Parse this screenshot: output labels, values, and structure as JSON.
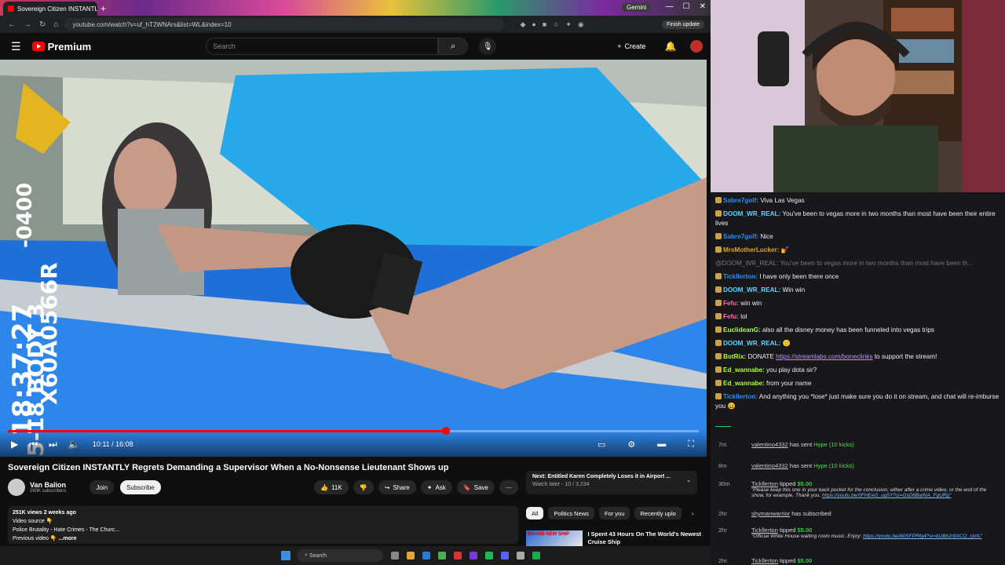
{
  "browser": {
    "tab_title": "Sovereign Citizen INSTANTLY R...",
    "new_tab": "+",
    "gemini": "Gemini",
    "url": "youtube.com/watch?v=uf_hT2WNArs&list=WL&index=10",
    "finish_update": "Finish update"
  },
  "youtube": {
    "logo": "Premium",
    "search_placeholder": "Search",
    "create": "Create"
  },
  "video": {
    "progress_fraction": 0.634,
    "time": "10:11 / 16:08",
    "overlay_text": "-0400",
    "overlay_text2": "18:37:27",
    "overlay_text3": "X60A0566R",
    "overlay_text4": "5-18  BODY 3"
  },
  "details": {
    "title": "Sovereign Citizen INSTANTLY Regrets Demanding a Supervisor When a No-Nonsense Lieutenant Shows up",
    "channel": "Van Balion",
    "subscribers": "260K subscribers",
    "join": "Join",
    "subscribe": "Subscribe",
    "likes": "11K",
    "share": "Share",
    "ask": "Ask",
    "save": "Save",
    "meta": "251K views  2 weeks ago",
    "desc_line1": "Video source 👇",
    "desc_line2": "Police Brutality - Hate Crimes - The Churc...",
    "desc_line3": "Previous video 👇",
    "more": "...more"
  },
  "next": {
    "label": "Next: Entitled Karen Completely Loses it in Airport ...",
    "sub": "Watch later - 10 / 3,234"
  },
  "chips": [
    "All",
    "Politics News",
    "For you",
    "Recently uplo"
  ],
  "recommendation": {
    "thumb_text": "BRAND NEW SHIP",
    "title": "I Spent 43 Hours On The World's Newest Cruise Ship"
  },
  "taskbar": {
    "search": "Search"
  },
  "chat": [
    {
      "user": "Sabre7golf",
      "color": "#1e90ff",
      "text": " Viva Las Vegas"
    },
    {
      "user": "DOOM_WR_REAL",
      "color": "#5bd3ff",
      "text": " You've been to vegas more in two months than most have been their entire lives"
    },
    {
      "user": "Sabre7golf",
      "color": "#1e90ff",
      "text": " Nice"
    },
    {
      "user": "MrsMotherLucker",
      "color": "#daa520",
      "text": " 💅"
    },
    {
      "user": "",
      "color": "#777",
      "text": "@DOOM_WR_REAL: You've been to vegas more in two months than most have been th..."
    },
    {
      "user": "Tickllerton",
      "color": "#1e90ff",
      "text": " I have only been there once"
    },
    {
      "user": "DOOM_WR_REAL",
      "color": "#5bd3ff",
      "text": " Win win"
    },
    {
      "user": "Fefu",
      "color": "#ff69b4",
      "text": " win win"
    },
    {
      "user": "Fefu",
      "color": "#ff69b4",
      "text": " lol"
    },
    {
      "user": "EuclideanG",
      "color": "#adff2f",
      "text": " also all the disney money has been funneled into vegas trips"
    },
    {
      "user": "DOOM_WR_REAL",
      "color": "#5bd3ff",
      "text": " 🙂"
    },
    {
      "user": "BotRix",
      "color": "#adff2f",
      "text": " DONATE ",
      "link": "https://streamlabs.com/boneclinks",
      "after": " to support the stream!"
    },
    {
      "user": "Ed_wannabe",
      "color": "#adff2f",
      "text": " you play dota sir?"
    },
    {
      "user": "Ed_wannabe",
      "color": "#adff2f",
      "text": " from your name"
    },
    {
      "user": "Tickllerton",
      "color": "#1e90ff",
      "text": " And anything you *lose* just make sure you do it on stream, and chat will re-imburse you 😀"
    }
  ],
  "events": [
    {
      "time": "7m",
      "user": "valentino4332",
      "text": " has sent ",
      "hl": "Hype (10 kicks)"
    },
    {
      "time": "8m",
      "user": "valentino4332",
      "text": " has sent ",
      "hl": "Hype (10 kicks)"
    },
    {
      "time": "30m",
      "user": "Tickllerton",
      "text": " tipped ",
      "money": "$5.00",
      "quote": "\"Please keep this one in your back pocket for the conclusion; either after a crime video, or the end of the show, for example. Thank you.",
      "qlink": "https://youtu.be/0FHEeG_ug5Y?si=GsD6BaINA_FqURg\""
    },
    {
      "time": "2hr",
      "user": "shymanwarrior",
      "text": " has subscribed"
    },
    {
      "time": "2hr",
      "user": "Tickllerton",
      "text": " tipped ",
      "money": "$5.00",
      "quote": "\"Official White House waiting room music. Enjoy: ",
      "qlink": "https://youtu.be/ill0SFPRfg4?si=bUBb2r8XCQ_cjnfs\""
    },
    {
      "time": "2hr",
      "user": "Tickllerton",
      "text": " tipped ",
      "money": "$5.00"
    }
  ]
}
